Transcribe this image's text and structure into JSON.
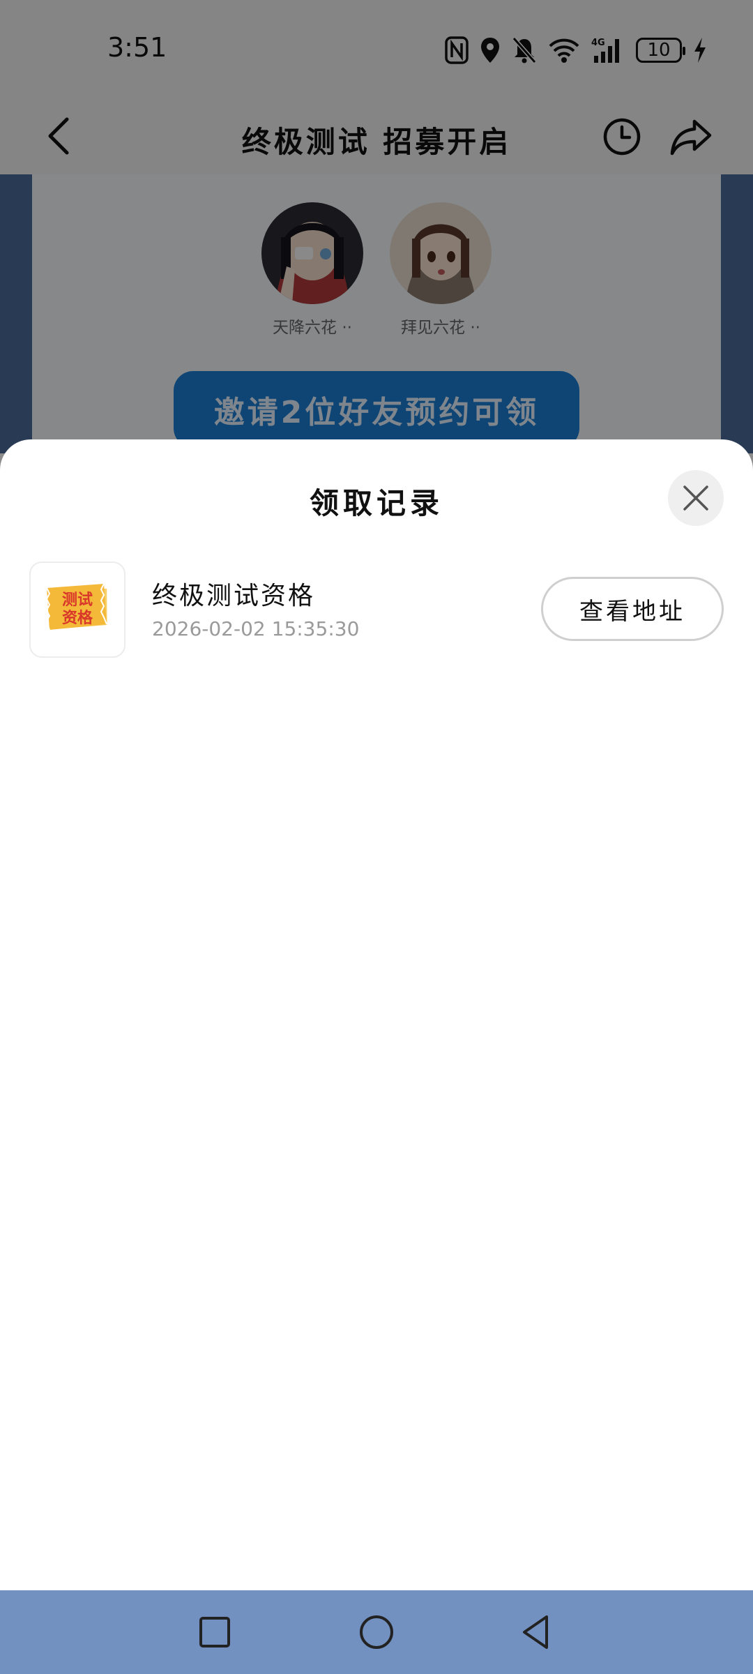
{
  "status_bar": {
    "time": "3:51",
    "battery_level": "10",
    "icons": [
      "nfc-icon",
      "location-icon",
      "mute-icon",
      "wifi-icon",
      "signal-4g-icon",
      "battery-icon",
      "charging-icon"
    ]
  },
  "header": {
    "title": "终极测试 招募开启"
  },
  "friends": [
    {
      "name": "天降六花 ··"
    },
    {
      "name": "拜见六花 ··"
    }
  ],
  "invite_button": {
    "label": "邀请2位好友预约可领"
  },
  "sheet": {
    "title": "领取记录",
    "records": [
      {
        "thumbnail_text": "测试资格",
        "name": "终极测试资格",
        "time": "2026-02-02 15:35:30",
        "action_label": "查看地址"
      }
    ]
  },
  "colors": {
    "accent_blue": "#1a7fd6",
    "nav_bar": "#7291c1",
    "side_panel": "#4a6a99",
    "ticket_yellow": "#f5c14a",
    "ticket_red": "#d8372a"
  }
}
